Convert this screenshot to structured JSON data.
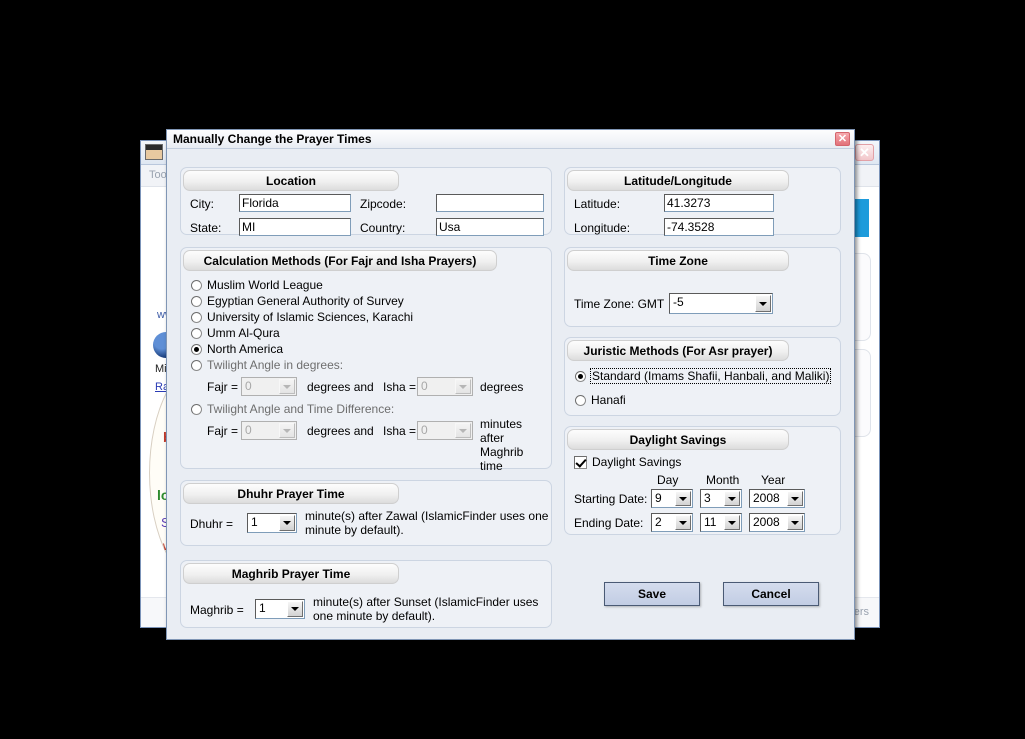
{
  "background_window": {
    "toolbar_label": "Too",
    "fragments": [
      "ww",
      "Mie",
      "Ra",
      "b",
      "lo",
      "S",
      "w"
    ],
    "status_text": "ers",
    "close_icon": "close-icon"
  },
  "dialog": {
    "title": "Manually Change the Prayer Times",
    "close_icon": "close-icon",
    "location": {
      "header": "Location",
      "city_label": "City:",
      "city_value": "Florida",
      "state_label": "State:",
      "state_value": "MI",
      "zipcode_label": "Zipcode:",
      "zipcode_value": "",
      "country_label": "Country:",
      "country_value": "Usa"
    },
    "calculation_methods": {
      "header": "Calculation Methods (For Fajr and Isha Prayers)",
      "options": [
        {
          "label": "Muslim World League",
          "selected": false
        },
        {
          "label": "Egyptian General Authority of Survey",
          "selected": false
        },
        {
          "label": "University of Islamic Sciences, Karachi",
          "selected": false
        },
        {
          "label": "Umm Al-Qura",
          "selected": false
        },
        {
          "label": "North America",
          "selected": true
        },
        {
          "label": "Twilight Angle in degrees:",
          "selected": false
        },
        {
          "label": "Twilight Angle and Time Difference:",
          "selected": false
        }
      ],
      "twilight_angle": {
        "fajr_label": "Fajr =",
        "fajr_value": "0",
        "mid_label": "degrees and",
        "isha_label": "Isha =",
        "isha_value": "0",
        "unit_label": "degrees"
      },
      "twilight_time_diff": {
        "fajr_label": "Fajr =",
        "fajr_value": "0",
        "mid_label": "degrees and",
        "isha_label": "Isha =",
        "isha_value": "0",
        "unit_label": "minutes after Maghrib time"
      }
    },
    "dhuhr": {
      "header": "Dhuhr Prayer Time",
      "label": "Dhuhr =",
      "value": "1",
      "note": "minute(s) after Zawal  (IslamicFinder uses one minute by default)."
    },
    "maghrib": {
      "header": "Maghrib Prayer Time",
      "label": "Maghrib =",
      "value": "1",
      "note": "minute(s) after Sunset (IslamicFinder uses one minute by default)."
    },
    "lat_long": {
      "header": "Latitude/Longitude",
      "latitude_label": "Latitude:",
      "latitude_value": "41.3273",
      "longitude_label": "Longitude:",
      "longitude_value": "-74.3528"
    },
    "time_zone": {
      "header": "Time Zone",
      "label": "Time Zone: GMT",
      "value": "-5"
    },
    "juristic_methods": {
      "header": "Juristic Methods (For Asr prayer)",
      "options": [
        {
          "label": "Standard (Imams Shafii, Hanbali, and Maliki)",
          "selected": true
        },
        {
          "label": "Hanafi",
          "selected": false
        }
      ]
    },
    "daylight_savings": {
      "header": "Daylight Savings",
      "checkbox_label": "Daylight Savings",
      "checked": true,
      "col_day": "Day",
      "col_month": "Month",
      "col_year": "Year",
      "start_label": "Starting Date:",
      "start_day": "9",
      "start_month": "3",
      "start_year": "2008",
      "end_label": "Ending Date:",
      "end_day": "2",
      "end_month": "11",
      "end_year": "2008"
    },
    "actions": {
      "save_label": "Save",
      "cancel_label": "Cancel"
    }
  }
}
